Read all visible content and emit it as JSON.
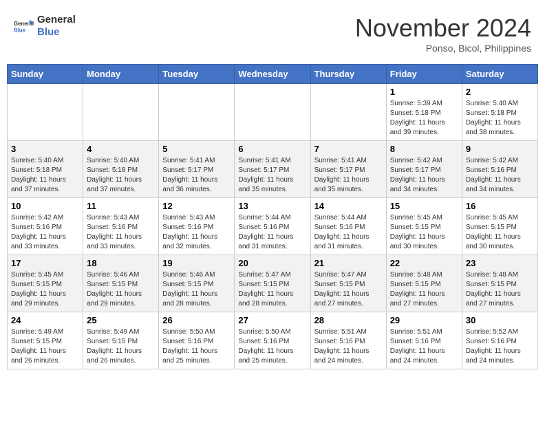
{
  "header": {
    "logo_line1": "General",
    "logo_line2": "Blue",
    "month": "November 2024",
    "location": "Ponso, Bicol, Philippines"
  },
  "weekdays": [
    "Sunday",
    "Monday",
    "Tuesday",
    "Wednesday",
    "Thursday",
    "Friday",
    "Saturday"
  ],
  "weeks": [
    [
      {
        "day": "",
        "info": ""
      },
      {
        "day": "",
        "info": ""
      },
      {
        "day": "",
        "info": ""
      },
      {
        "day": "",
        "info": ""
      },
      {
        "day": "",
        "info": ""
      },
      {
        "day": "1",
        "info": "Sunrise: 5:39 AM\nSunset: 5:18 PM\nDaylight: 11 hours\nand 39 minutes."
      },
      {
        "day": "2",
        "info": "Sunrise: 5:40 AM\nSunset: 5:18 PM\nDaylight: 11 hours\nand 38 minutes."
      }
    ],
    [
      {
        "day": "3",
        "info": "Sunrise: 5:40 AM\nSunset: 5:18 PM\nDaylight: 11 hours\nand 37 minutes."
      },
      {
        "day": "4",
        "info": "Sunrise: 5:40 AM\nSunset: 5:18 PM\nDaylight: 11 hours\nand 37 minutes."
      },
      {
        "day": "5",
        "info": "Sunrise: 5:41 AM\nSunset: 5:17 PM\nDaylight: 11 hours\nand 36 minutes."
      },
      {
        "day": "6",
        "info": "Sunrise: 5:41 AM\nSunset: 5:17 PM\nDaylight: 11 hours\nand 35 minutes."
      },
      {
        "day": "7",
        "info": "Sunrise: 5:41 AM\nSunset: 5:17 PM\nDaylight: 11 hours\nand 35 minutes."
      },
      {
        "day": "8",
        "info": "Sunrise: 5:42 AM\nSunset: 5:17 PM\nDaylight: 11 hours\nand 34 minutes."
      },
      {
        "day": "9",
        "info": "Sunrise: 5:42 AM\nSunset: 5:16 PM\nDaylight: 11 hours\nand 34 minutes."
      }
    ],
    [
      {
        "day": "10",
        "info": "Sunrise: 5:42 AM\nSunset: 5:16 PM\nDaylight: 11 hours\nand 33 minutes."
      },
      {
        "day": "11",
        "info": "Sunrise: 5:43 AM\nSunset: 5:16 PM\nDaylight: 11 hours\nand 33 minutes."
      },
      {
        "day": "12",
        "info": "Sunrise: 5:43 AM\nSunset: 5:16 PM\nDaylight: 11 hours\nand 32 minutes."
      },
      {
        "day": "13",
        "info": "Sunrise: 5:44 AM\nSunset: 5:16 PM\nDaylight: 11 hours\nand 31 minutes."
      },
      {
        "day": "14",
        "info": "Sunrise: 5:44 AM\nSunset: 5:16 PM\nDaylight: 11 hours\nand 31 minutes."
      },
      {
        "day": "15",
        "info": "Sunrise: 5:45 AM\nSunset: 5:15 PM\nDaylight: 11 hours\nand 30 minutes."
      },
      {
        "day": "16",
        "info": "Sunrise: 5:45 AM\nSunset: 5:15 PM\nDaylight: 11 hours\nand 30 minutes."
      }
    ],
    [
      {
        "day": "17",
        "info": "Sunrise: 5:45 AM\nSunset: 5:15 PM\nDaylight: 11 hours\nand 29 minutes."
      },
      {
        "day": "18",
        "info": "Sunrise: 5:46 AM\nSunset: 5:15 PM\nDaylight: 11 hours\nand 29 minutes."
      },
      {
        "day": "19",
        "info": "Sunrise: 5:46 AM\nSunset: 5:15 PM\nDaylight: 11 hours\nand 28 minutes."
      },
      {
        "day": "20",
        "info": "Sunrise: 5:47 AM\nSunset: 5:15 PM\nDaylight: 11 hours\nand 28 minutes."
      },
      {
        "day": "21",
        "info": "Sunrise: 5:47 AM\nSunset: 5:15 PM\nDaylight: 11 hours\nand 27 minutes."
      },
      {
        "day": "22",
        "info": "Sunrise: 5:48 AM\nSunset: 5:15 PM\nDaylight: 11 hours\nand 27 minutes."
      },
      {
        "day": "23",
        "info": "Sunrise: 5:48 AM\nSunset: 5:15 PM\nDaylight: 11 hours\nand 27 minutes."
      }
    ],
    [
      {
        "day": "24",
        "info": "Sunrise: 5:49 AM\nSunset: 5:15 PM\nDaylight: 11 hours\nand 26 minutes."
      },
      {
        "day": "25",
        "info": "Sunrise: 5:49 AM\nSunset: 5:15 PM\nDaylight: 11 hours\nand 26 minutes."
      },
      {
        "day": "26",
        "info": "Sunrise: 5:50 AM\nSunset: 5:16 PM\nDaylight: 11 hours\nand 25 minutes."
      },
      {
        "day": "27",
        "info": "Sunrise: 5:50 AM\nSunset: 5:16 PM\nDaylight: 11 hours\nand 25 minutes."
      },
      {
        "day": "28",
        "info": "Sunrise: 5:51 AM\nSunset: 5:16 PM\nDaylight: 11 hours\nand 24 minutes."
      },
      {
        "day": "29",
        "info": "Sunrise: 5:51 AM\nSunset: 5:16 PM\nDaylight: 11 hours\nand 24 minutes."
      },
      {
        "day": "30",
        "info": "Sunrise: 5:52 AM\nSunset: 5:16 PM\nDaylight: 11 hours\nand 24 minutes."
      }
    ]
  ]
}
